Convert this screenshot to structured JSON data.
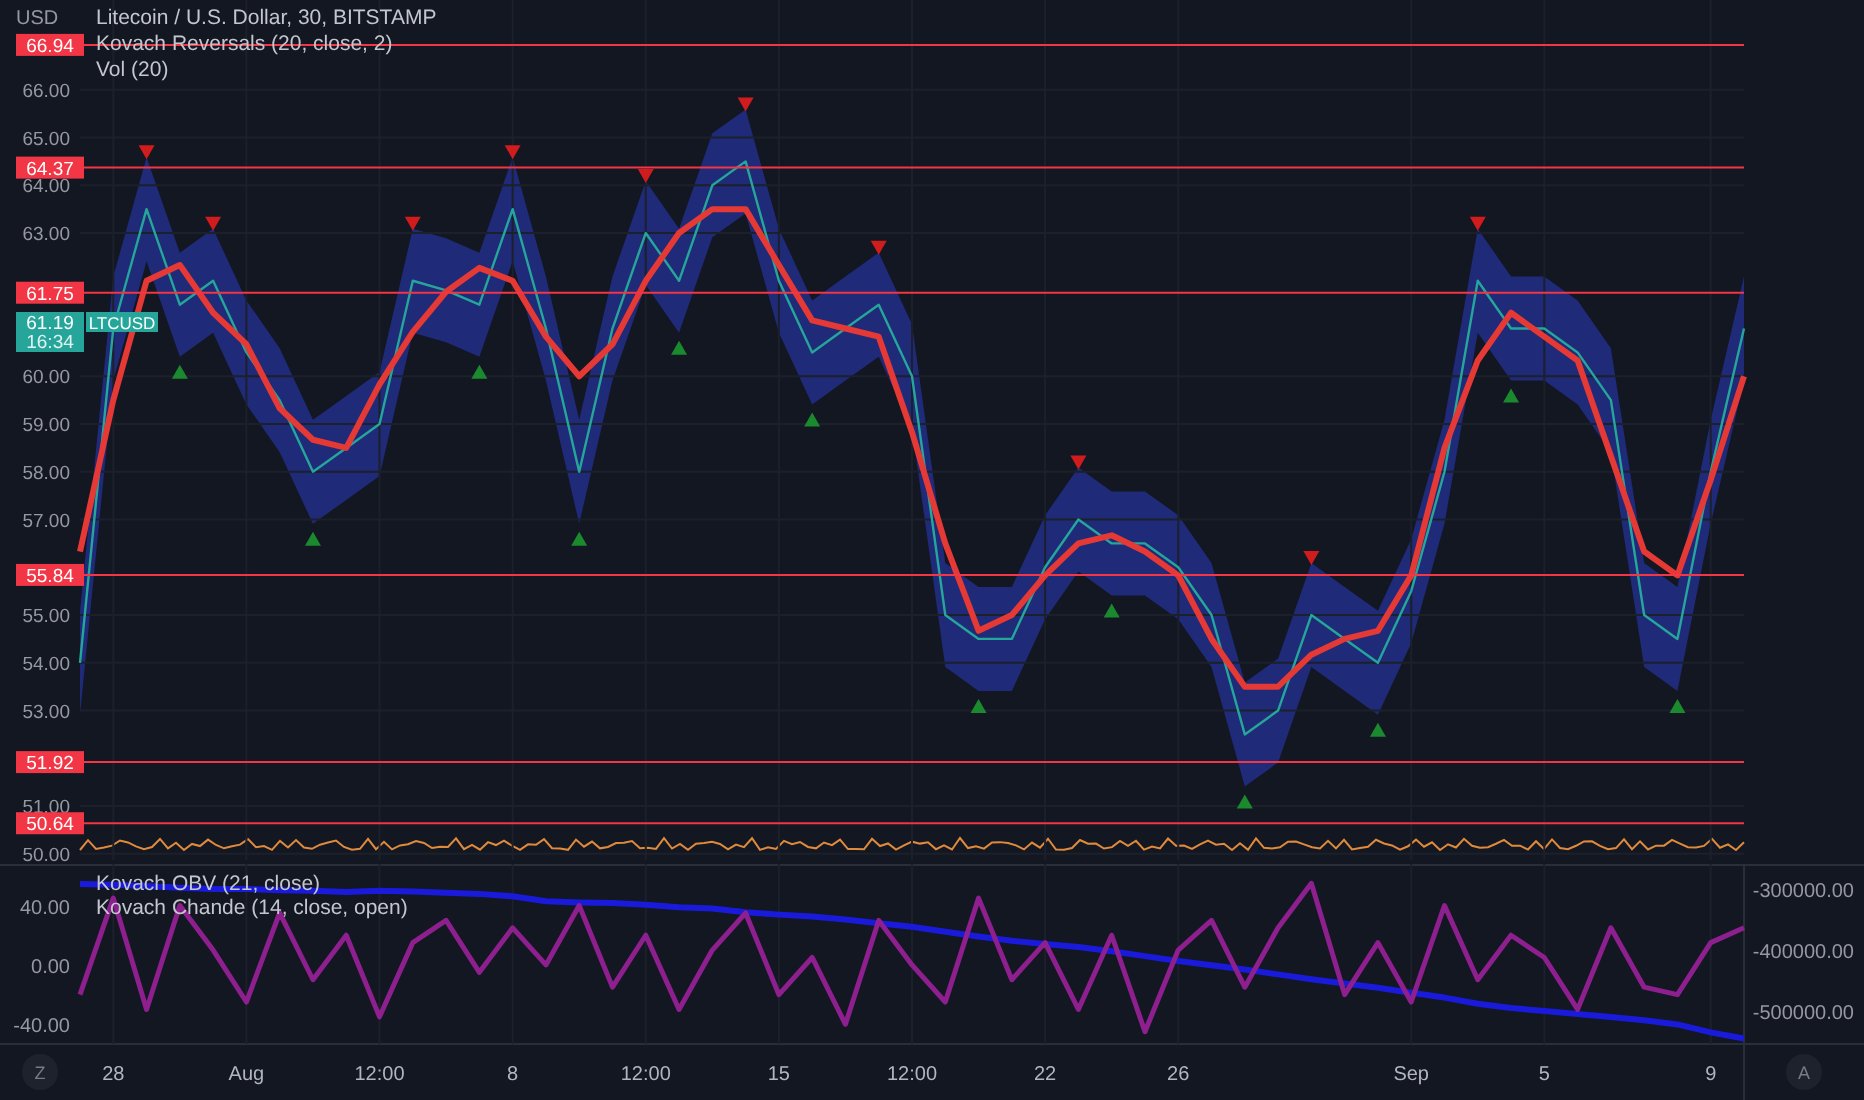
{
  "price_pane": {
    "currency": "USD",
    "price_badge": {
      "price": "61.19",
      "countdown": "16:34"
    },
    "chart_data": {
      "type": "line",
      "title": "Litecoin / U.S. Dollar, 30, BITSTAMP",
      "ylim": [
        49.87,
        67.88
      ],
      "grid": true,
      "legend": "upper left",
      "series": [
        {
          "name": "LTCUSD",
          "color": "#26a69a",
          "values": [
            54,
            61,
            63.5,
            61.5,
            62,
            60.5,
            59.5,
            58,
            58.5,
            59,
            62,
            61.8,
            61.5,
            63.5,
            61,
            58,
            61,
            63,
            62,
            64,
            64.5,
            62,
            60.5,
            61,
            61.5,
            60,
            55,
            54.5,
            54.5,
            56,
            57,
            56.5,
            56.5,
            56,
            55,
            52.5,
            53,
            55,
            54.5,
            54,
            55.5,
            58,
            62,
            61,
            61,
            60.5,
            59.5,
            55,
            54.5,
            58,
            61
          ]
        },
        {
          "name": "Kovach Reversals (20, close, 2)",
          "color": "#e53935",
          "values": [
            56.33,
            59.5,
            62,
            62.33,
            61.33,
            60.67,
            59.33,
            58.67,
            58.5,
            59.83,
            60.93,
            61.77,
            62.27,
            62,
            60.83,
            60,
            60.67,
            62,
            63,
            63.5,
            63.5,
            62.33,
            61.17,
            61,
            60.83,
            58.83,
            56.5,
            54.67,
            55,
            55.83,
            56.5,
            56.67,
            56.33,
            55.83,
            54.5,
            53.5,
            53.5,
            54.17,
            54.5,
            54.67,
            55.83,
            58.5,
            60.33,
            61.33,
            60.83,
            60.33,
            58.33,
            56.33,
            55.83,
            57.83,
            60
          ]
        }
      ],
      "yticks": [
        {
          "value": 50,
          "label": "50.00"
        },
        {
          "value": 51,
          "label": "51.00"
        },
        {
          "value": 53,
          "label": "53.00"
        },
        {
          "value": 54,
          "label": "54.00"
        },
        {
          "value": 55,
          "label": "55.00"
        },
        {
          "value": 57,
          "label": "57.00"
        },
        {
          "value": 58,
          "label": "58.00"
        },
        {
          "value": 59,
          "label": "59.00"
        },
        {
          "value": 60,
          "label": "60.00"
        },
        {
          "value": 63,
          "label": "63.00"
        },
        {
          "value": 64,
          "label": "64.00"
        },
        {
          "value": 65,
          "label": "65.00"
        },
        {
          "value": 66,
          "label": "66.00"
        }
      ],
      "ref_lines": [
        {
          "axis": "y",
          "value": 66.94,
          "label": "66.94"
        },
        {
          "axis": "y",
          "value": 64.37,
          "label": "64.37"
        },
        {
          "axis": "y",
          "value": 61.75,
          "label": "61.75"
        },
        {
          "axis": "y",
          "value": 55.84,
          "label": "55.84"
        },
        {
          "axis": "y",
          "value": 51.92,
          "label": "51.92"
        },
        {
          "axis": "y",
          "value": 50.64,
          "label": "50.64"
        }
      ]
    },
    "volume_legend": "Vol (20)"
  },
  "indicator_pane": {
    "chart_data": {
      "type": "line",
      "grid": true,
      "legend": "upper left",
      "categories": [
        null,
        "28",
        null,
        null,
        null,
        "Aug",
        null,
        null,
        null,
        "12:00",
        null,
        null,
        null,
        "8",
        null,
        null,
        null,
        "12:00",
        null,
        null,
        null,
        "15",
        null,
        null,
        null,
        "12:00",
        null,
        null,
        null,
        "22",
        null,
        null,
        null,
        "26",
        null,
        null,
        null,
        null,
        null,
        null,
        "Sep",
        null,
        null,
        null,
        "5",
        null,
        null,
        null,
        null,
        "9",
        null
      ],
      "ylim": [
        -53.3,
        68
      ],
      "y2lim": [
        -554098,
        -259016
      ],
      "series": [
        {
          "name": "Kovach OBV (21, close)",
          "color": "#1a1adb",
          "axis": "y2",
          "values": [
            -292000,
            -293000,
            -295000,
            -298000,
            -300000,
            -300000,
            -302000,
            -303000,
            -305000,
            -303000,
            -304000,
            -306000,
            -308000,
            -312000,
            -320000,
            -322000,
            -323000,
            -326000,
            -330000,
            -332000,
            -338000,
            -342000,
            -345000,
            -350000,
            -356000,
            -362000,
            -370000,
            -378000,
            -385000,
            -390000,
            -395000,
            -402000,
            -410000,
            -418000,
            -425000,
            -432000,
            -440000,
            -448000,
            -455000,
            -462000,
            -470000,
            -478000,
            -488000,
            -495000,
            -500000,
            -505000,
            -510000,
            -515000,
            -522000,
            -535000,
            -545000
          ]
        },
        {
          "name": "Kovach Chande (14, close, open)",
          "color": "#8e1f8e",
          "axis": "y",
          "values": [
            -20,
            45,
            -30,
            40,
            10,
            -25,
            35,
            -10,
            20,
            -35,
            15,
            30,
            -5,
            25,
            0,
            40,
            -15,
            20,
            -30,
            10,
            35,
            -20,
            5,
            -40,
            30,
            0,
            -25,
            45,
            -10,
            15,
            -30,
            20,
            -45,
            10,
            30,
            -15,
            25,
            55,
            -20,
            15,
            -25,
            40,
            -10,
            20,
            5,
            -30,
            25,
            -15,
            -20,
            15,
            25
          ]
        }
      ],
      "yticks": [
        {
          "value": -40,
          "label": "-40.00"
        },
        {
          "value": 0,
          "label": "0.00"
        },
        {
          "value": 40,
          "label": "40.00"
        }
      ],
      "y2ticks": [
        {
          "value": -500000,
          "label": "-500000.00"
        },
        {
          "value": -400000,
          "label": "-400000.00"
        },
        {
          "value": -300000,
          "label": "-300000.00"
        }
      ]
    }
  },
  "axis_buttons": [
    "Z",
    "A"
  ]
}
